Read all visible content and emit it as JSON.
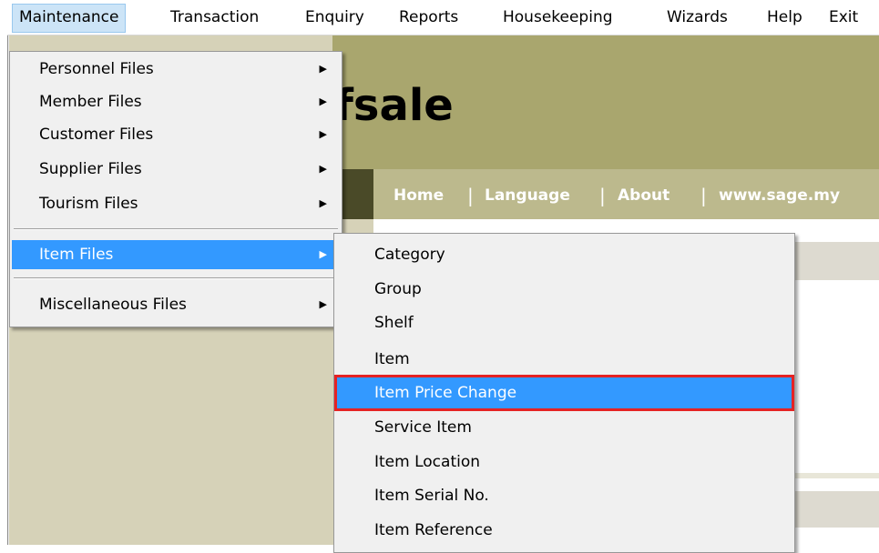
{
  "menubar": {
    "items": [
      "Maintenance",
      "Transaction",
      "Enquiry",
      "Reports",
      "Housekeeping",
      "Wizards",
      "Help",
      "Exit"
    ],
    "active_index": 0
  },
  "background": {
    "logo_text": "fsale",
    "nav_links": [
      "Home",
      "Language",
      "About",
      "www.sage.my"
    ],
    "nav_separator": "|",
    "colors": {
      "banner": "#a9a66e",
      "nav": "#bcb98d",
      "left_panel": "#d6d2b8"
    }
  },
  "maintenance_menu": {
    "items": [
      {
        "label": "Personnel Files",
        "has_submenu": true
      },
      {
        "label": "Member Files",
        "has_submenu": true
      },
      {
        "label": "Customer Files",
        "has_submenu": true
      },
      {
        "label": "Supplier Files",
        "has_submenu": true
      },
      {
        "label": "Tourism Files",
        "has_submenu": true
      },
      {
        "label": "Item Files",
        "has_submenu": true,
        "highlighted": true
      },
      {
        "label": "Miscellaneous Files",
        "has_submenu": true
      }
    ]
  },
  "item_files_submenu": {
    "items": [
      {
        "label": "Category"
      },
      {
        "label": "Group"
      },
      {
        "label": "Shelf"
      },
      {
        "label": "Item"
      },
      {
        "label": "Item Price Change",
        "highlighted": true
      },
      {
        "label": "Service Item"
      },
      {
        "label": "Item Location"
      },
      {
        "label": "Item Serial No."
      },
      {
        "label": "Item Reference"
      }
    ]
  },
  "icons": {
    "submenu_arrow": "▶"
  },
  "colors": {
    "highlight": "#3399ff",
    "callout_border": "#e52323",
    "menubar_active": "#cce4f7"
  }
}
